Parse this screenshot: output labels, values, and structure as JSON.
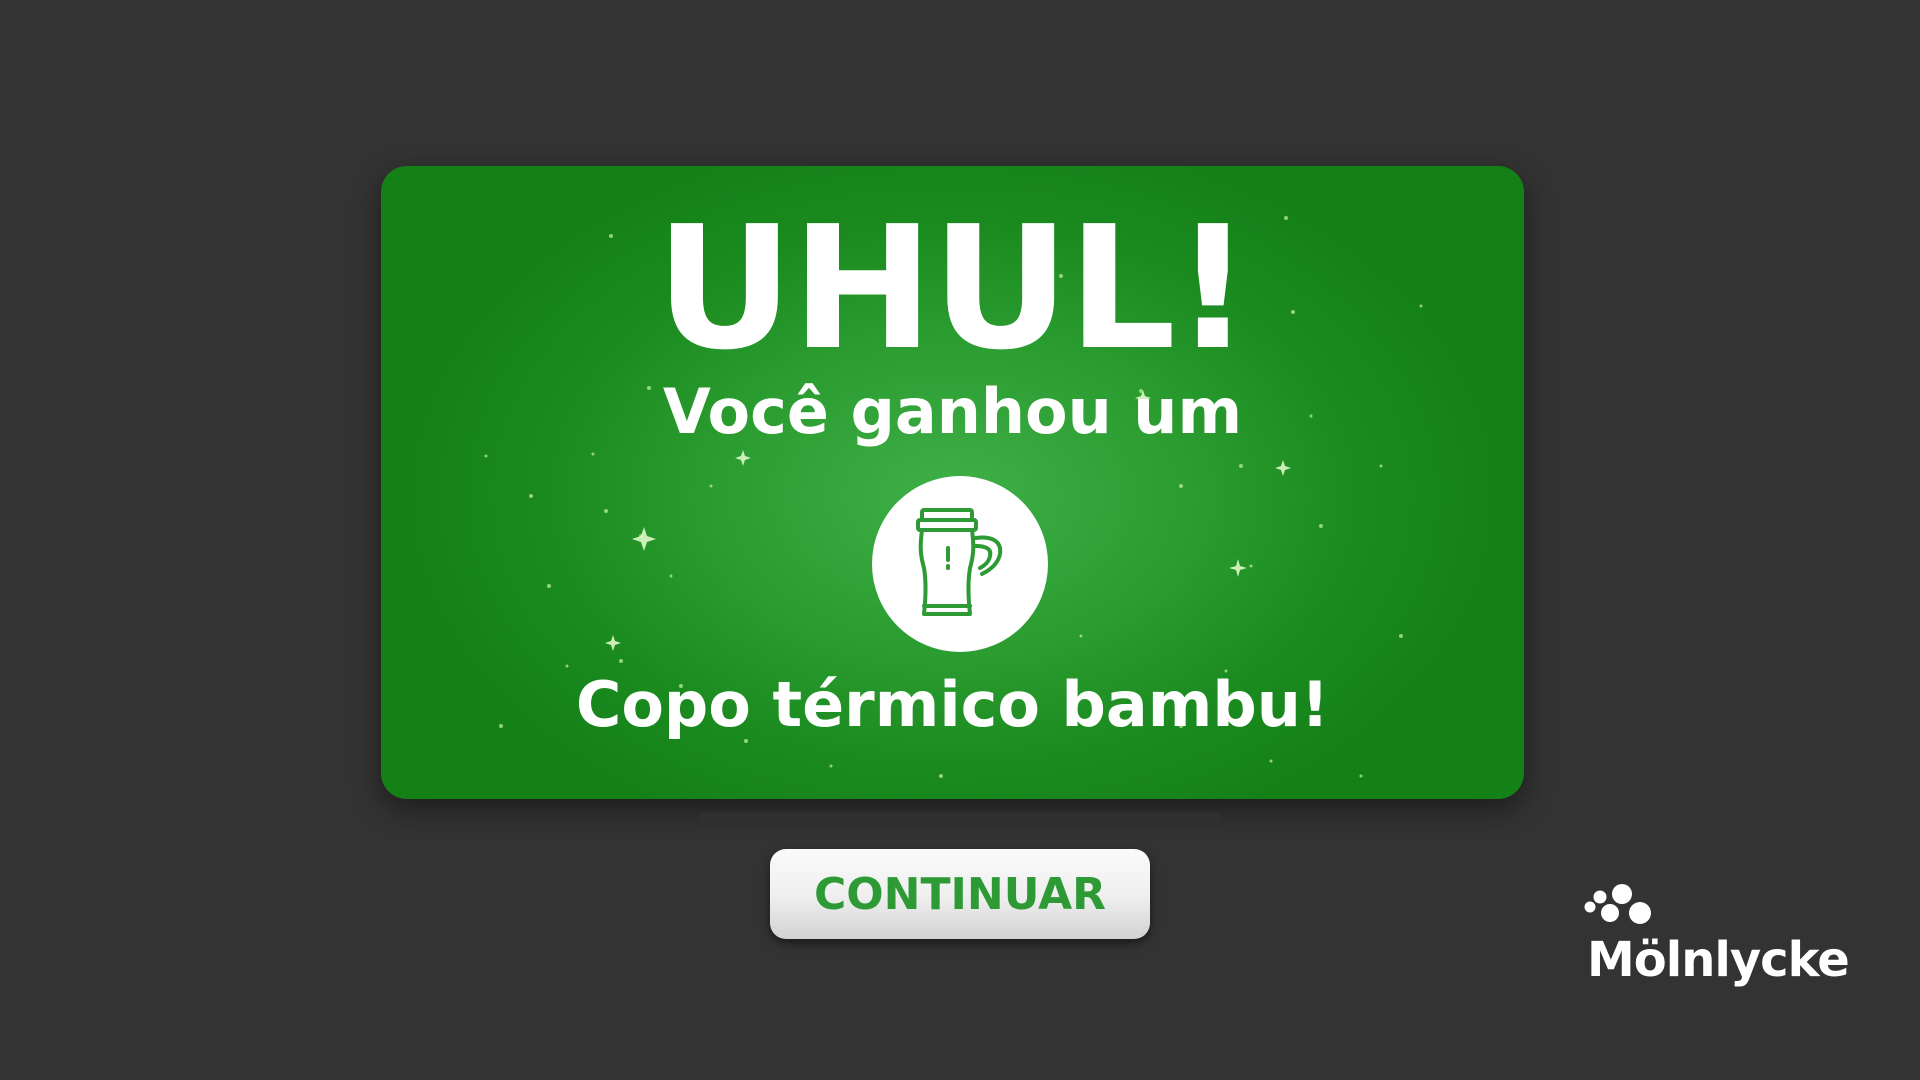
{
  "prize_card": {
    "headline": "UHUL!",
    "subline": "Você ganhou um",
    "prize_icon": "travel-mug-icon",
    "prize_name": "Copo térmico bambu!"
  },
  "actions": {
    "continue_label": "CONTINUAR"
  },
  "brand": {
    "name": "Mölnlycke",
    "logo_icon": "molnlycke-dots-logo"
  },
  "colors": {
    "background": "#333333",
    "card_green": "#1a8a1f",
    "card_green_highlight": "#3fb047",
    "button_text_green": "#2e9a35",
    "text_white": "#ffffff"
  }
}
